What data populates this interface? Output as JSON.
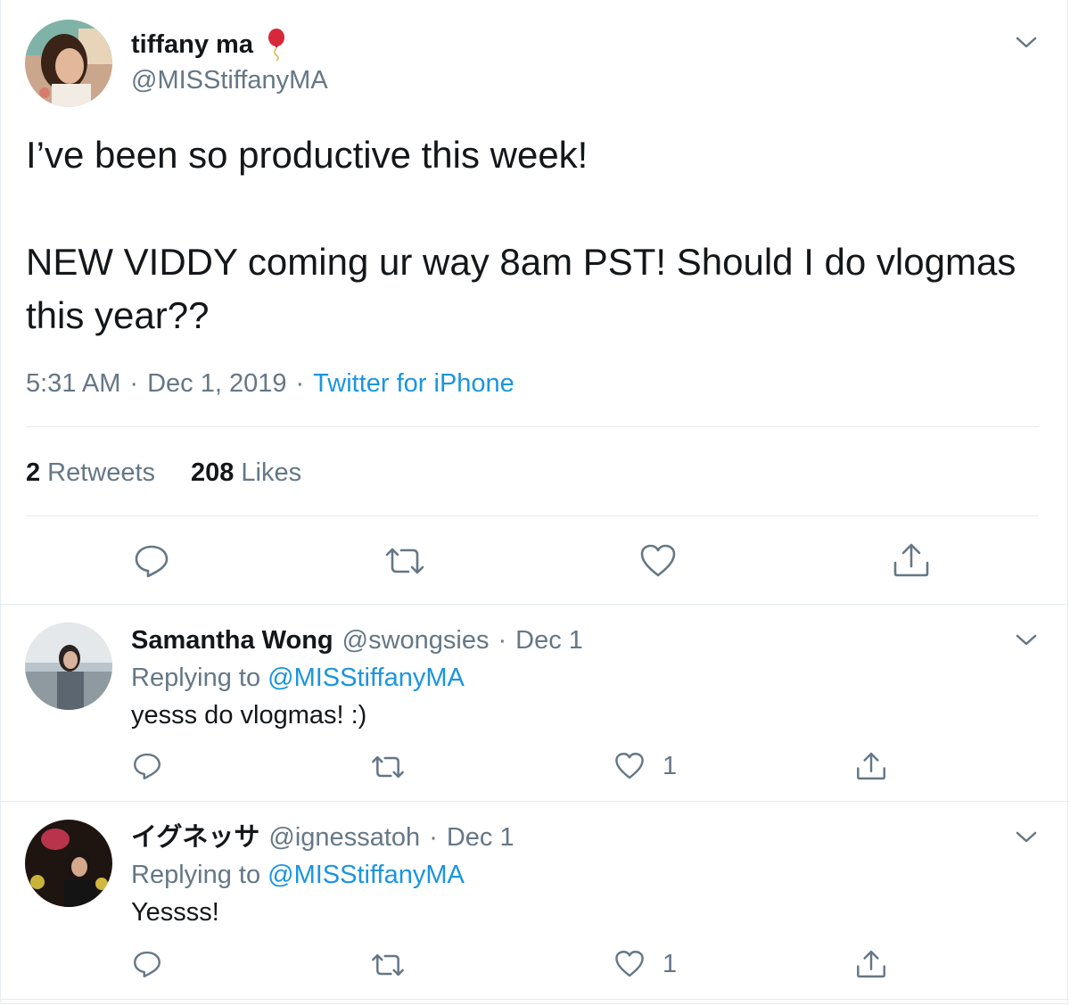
{
  "tweet": {
    "author_name": "tiffany ma",
    "author_handle": "@MISStiffanyMA",
    "name_emoji": "balloon-icon",
    "text": "I’ve been so productive this week!\n\nNEW VIDDY coming ur way 8am PST! Should I do vlogmas this year??",
    "time": "5:31 AM",
    "date": "Dec 1, 2019",
    "separator": "·",
    "source": "Twitter for iPhone",
    "retweets_count": "2",
    "retweets_label": "Retweets",
    "likes_count": "208",
    "likes_label": "Likes"
  },
  "replies": [
    {
      "name": "Samantha Wong",
      "handle": "@swongsies",
      "separator": "·",
      "date": "Dec 1",
      "replying_label": "Replying to",
      "replying_to": "@MISStiffanyMA",
      "text": "yesss do vlogmas! :)",
      "likes": "1"
    },
    {
      "name": "イグネッサ",
      "handle": "@ignessatoh",
      "separator": "·",
      "date": "Dec 1",
      "replying_label": "Replying to",
      "replying_to": "@MISStiffanyMA",
      "text": "Yessss!",
      "likes": "1"
    }
  ],
  "colors": {
    "link": "#1b95e0",
    "secondary_text": "#657786",
    "primary_text": "#14171a",
    "divider": "#e6ecf0"
  }
}
